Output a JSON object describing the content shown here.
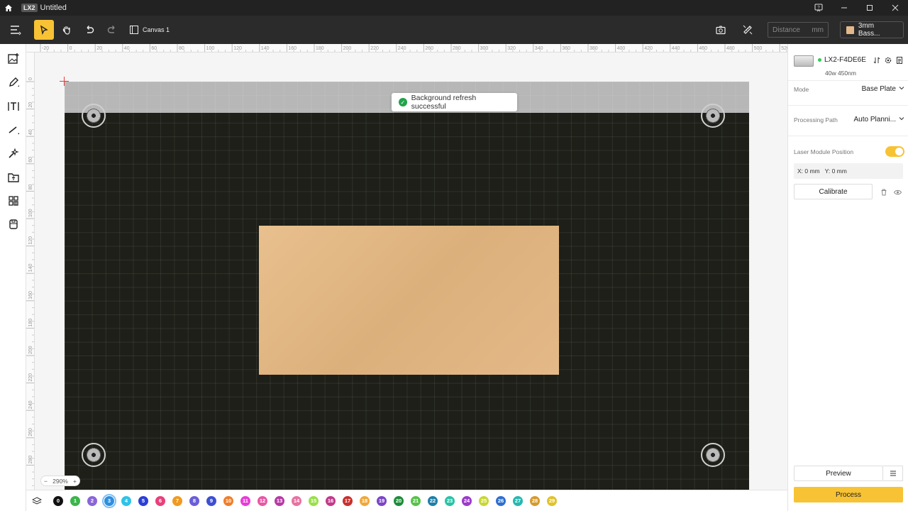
{
  "app": {
    "logo": "LX2",
    "doc_title": "Untitled"
  },
  "toolbar": {
    "canvas_tab": "Canvas 1",
    "distance_placeholder": "Distance",
    "distance_unit": "mm",
    "material": "3mm Bass..."
  },
  "ruler": {
    "top_ticks": [
      "-20",
      "0",
      "20",
      "40",
      "60",
      "80",
      "100",
      "120",
      "140",
      "160",
      "180",
      "200",
      "220",
      "240",
      "260",
      "280",
      "300",
      "320",
      "340",
      "360",
      "380",
      "400",
      "420",
      "440",
      "460",
      "480",
      "500",
      "520"
    ],
    "left_ticks": [
      "0",
      "20",
      "40",
      "60",
      "80",
      "100",
      "120",
      "140",
      "160",
      "180",
      "200",
      "220",
      "240",
      "260",
      "280"
    ]
  },
  "canvas": {
    "toast": "Background refresh successful",
    "zoom": "290%"
  },
  "layers": {
    "items": [
      {
        "label": "0",
        "color": "#111111"
      },
      {
        "label": "1",
        "color": "#3bb54a"
      },
      {
        "label": "2",
        "color": "#8a66d6"
      },
      {
        "label": "3",
        "color": "#2f8fe0"
      },
      {
        "label": "4",
        "color": "#2fc3e8"
      },
      {
        "label": "5",
        "color": "#2b3fd6"
      },
      {
        "label": "6",
        "color": "#e8407a"
      },
      {
        "label": "7",
        "color": "#f19a1f"
      },
      {
        "label": "8",
        "color": "#6a5ed9"
      },
      {
        "label": "9",
        "color": "#3d4fd1"
      },
      {
        "label": "10",
        "color": "#ef7e2a"
      },
      {
        "label": "11",
        "color": "#e83bd6"
      },
      {
        "label": "12",
        "color": "#e857a5"
      },
      {
        "label": "13",
        "color": "#b73aa5"
      },
      {
        "label": "14",
        "color": "#e872a2"
      },
      {
        "label": "15",
        "color": "#9adf4b"
      },
      {
        "label": "16",
        "color": "#c23a8a"
      },
      {
        "label": "17",
        "color": "#c9302c"
      },
      {
        "label": "18",
        "color": "#f0a83a"
      },
      {
        "label": "19",
        "color": "#7b45c9"
      },
      {
        "label": "20",
        "color": "#1e8c3a"
      },
      {
        "label": "21",
        "color": "#58c24a"
      },
      {
        "label": "22",
        "color": "#1f7fa8"
      },
      {
        "label": "23",
        "color": "#27c4a6"
      },
      {
        "label": "24",
        "color": "#9c3acb"
      },
      {
        "label": "25",
        "color": "#c8d735"
      },
      {
        "label": "26",
        "color": "#2e6fd1"
      },
      {
        "label": "27",
        "color": "#27b7b0"
      },
      {
        "label": "28",
        "color": "#d69a2e"
      },
      {
        "label": "29",
        "color": "#e0c32a"
      }
    ]
  },
  "panel": {
    "device_name": "LX2-F4DE6E",
    "device_spec": "40w 450nm",
    "mode_label": "Mode",
    "mode_value": "Base Plate",
    "path_label": "Processing Path",
    "path_value": "Auto Planni...",
    "laser_pos_label": "Laser Module Position",
    "laser_pos_enabled": true,
    "x_pos": "X: 0 mm",
    "y_pos": "Y: 0 mm",
    "calibrate": "Calibrate",
    "preview": "Preview",
    "process": "Process"
  },
  "colors": {
    "accent": "#f7c234",
    "dark": "#2b2b2b",
    "success": "#21a34a"
  }
}
